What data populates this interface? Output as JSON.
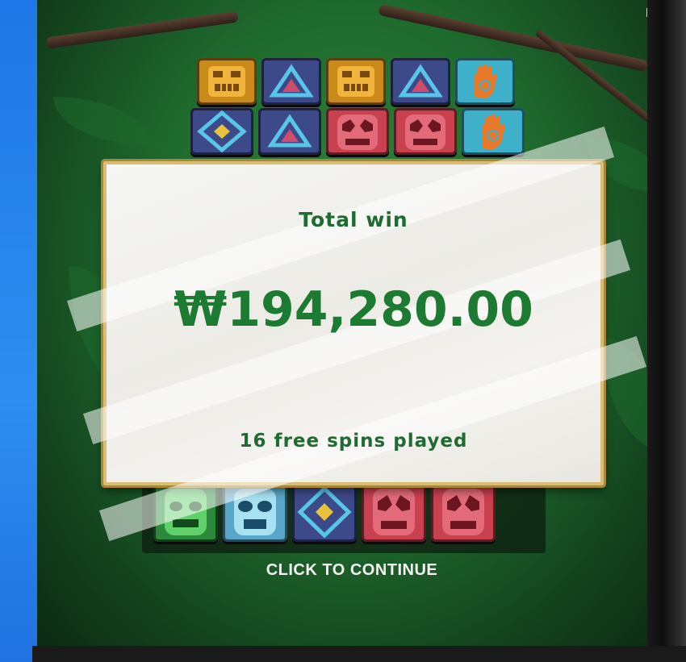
{
  "game": {
    "brand_mark": "H",
    "win_popup": {
      "title": "Total win",
      "amount": "₩194,280.00",
      "spins_played": "16 free spins played"
    },
    "continue_prompt": "CLICK TO CONTINUE"
  },
  "reels": {
    "top_row": [
      {
        "symbol": "gold-totem"
      },
      {
        "symbol": "blue-triangle"
      },
      {
        "symbol": "gold-totem"
      },
      {
        "symbol": "blue-triangle"
      },
      {
        "symbol": "turquoise-hand"
      }
    ],
    "second_row": [
      {
        "symbol": "blue-diamond"
      },
      {
        "symbol": "blue-triangle"
      },
      {
        "symbol": "red-mask"
      },
      {
        "symbol": "red-mask"
      },
      {
        "symbol": "turquoise-hand"
      }
    ],
    "bottom_row": [
      {
        "symbol": "green-mask"
      },
      {
        "symbol": "blue-mask"
      },
      {
        "symbol": "blue-diamond"
      },
      {
        "symbol": "red-mask"
      },
      {
        "symbol": "red-mask"
      }
    ]
  },
  "colors": {
    "win_text": "#1c7a32",
    "panel_border": "#d8bd72",
    "jungle": "#1f6b2e"
  }
}
